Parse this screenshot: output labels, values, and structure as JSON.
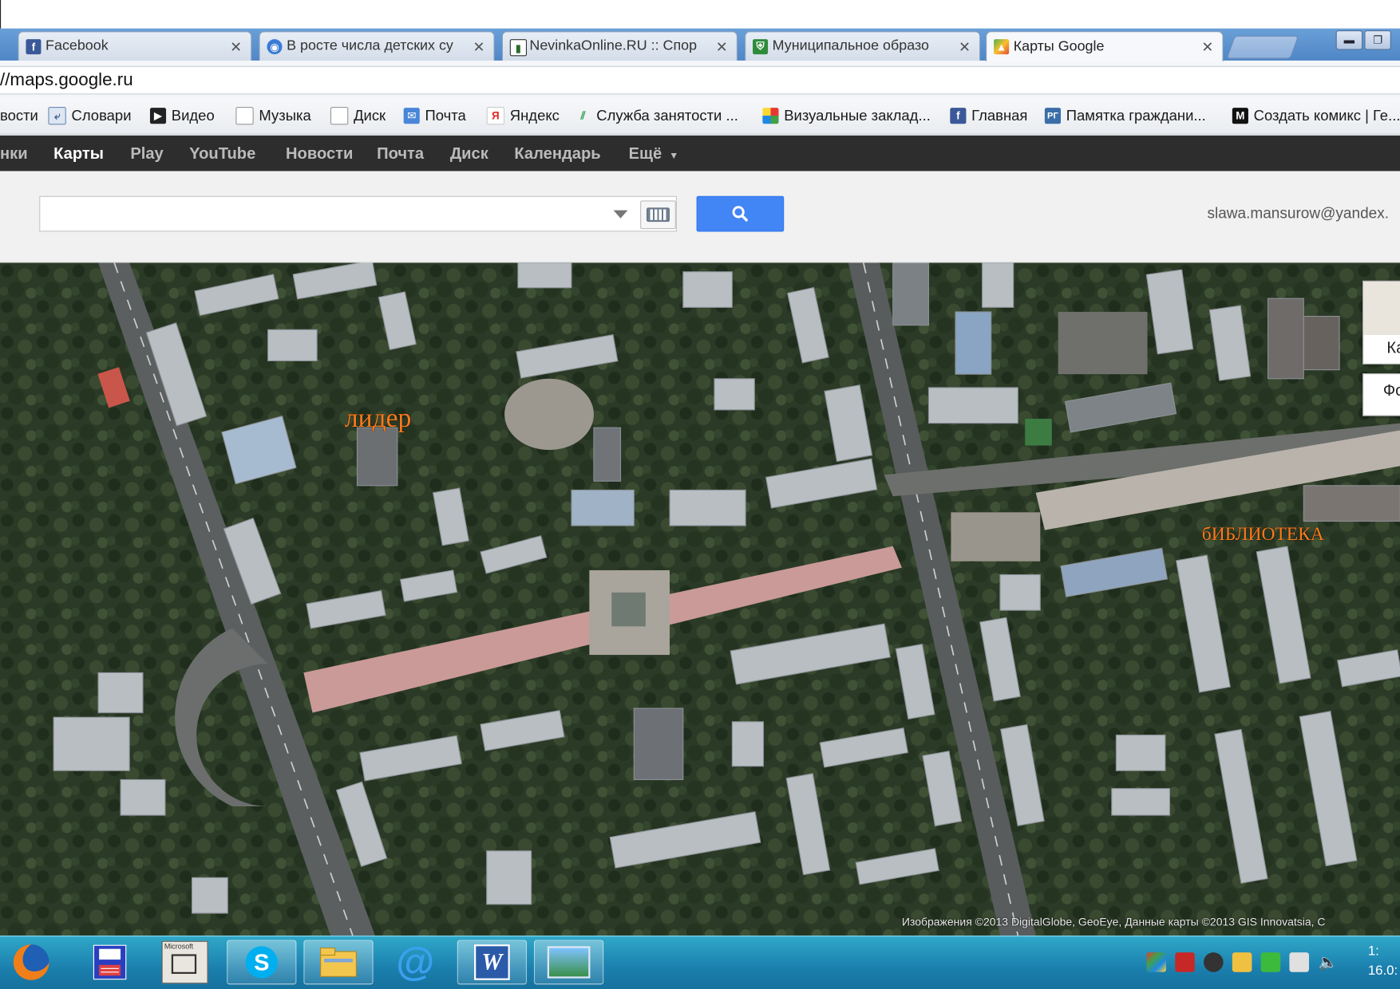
{
  "browser": {
    "tabs": [
      {
        "label": "Facebook",
        "icon": "facebook-icon",
        "color": "#3b5998"
      },
      {
        "label": "В росте числа детских су",
        "icon": "globe-icon",
        "color": "#3a7bd5"
      },
      {
        "label": "NevinkaOnline.RU :: Спор",
        "icon": "news-icon",
        "color": "#2a6a2a"
      },
      {
        "label": "Муниципальное образо",
        "icon": "emblem-icon",
        "color": "#2e8b3a"
      },
      {
        "label": "Карты Google",
        "icon": "maps-icon",
        "color": "#e04a3a"
      }
    ],
    "address": "//maps.google.ru",
    "bookmarks": [
      {
        "label": "вости",
        "icon": "page-icon"
      },
      {
        "label": "Словари",
        "icon": "dictionary-icon"
      },
      {
        "label": "Видео",
        "icon": "video-icon"
      },
      {
        "label": "Музыка",
        "icon": "page-icon"
      },
      {
        "label": "Диск",
        "icon": "page-icon"
      },
      {
        "label": "Почта",
        "icon": "mail-icon"
      },
      {
        "label": "Яндекс",
        "icon": "yandex-icon"
      },
      {
        "label": "Служба занятости ...",
        "icon": "employment-icon"
      },
      {
        "label": "Визуальные заклад...",
        "icon": "grid-icon"
      },
      {
        "label": "Главная",
        "icon": "facebook-icon"
      },
      {
        "label": "Памятка граждани...",
        "icon": "rg-icon"
      },
      {
        "label": "Создать комикс | Ге...",
        "icon": "comic-icon"
      }
    ]
  },
  "google_bar": {
    "items": [
      "нки",
      "Карты",
      "Play",
      "YouTube",
      "Новости",
      "Почта",
      "Диск",
      "Календарь",
      "Ещё"
    ],
    "current": "Карты"
  },
  "search": {
    "value": "",
    "user": "slawa.mansurow@yandex."
  },
  "map": {
    "labels": {
      "lider": "лидер",
      "library": "бИБЛИОТЕКА"
    },
    "map_type_1": "Ка",
    "map_type_2": "Фо",
    "copyright": "Изображения ©2013 DigitalGlobe, GeoEye, Данные карты ©2013 GIS Innovatsia, C"
  },
  "taskbar": {
    "apps": [
      "firefox-icon",
      "save-disk-icon",
      "microsoft-clip-icon",
      "skype-icon",
      "folder-icon",
      "mail-at-icon",
      "word-icon",
      "picture-viewer-icon"
    ],
    "microsoft_label": "Microsoft",
    "clock_time": "1:",
    "clock_date": "16.0:"
  }
}
